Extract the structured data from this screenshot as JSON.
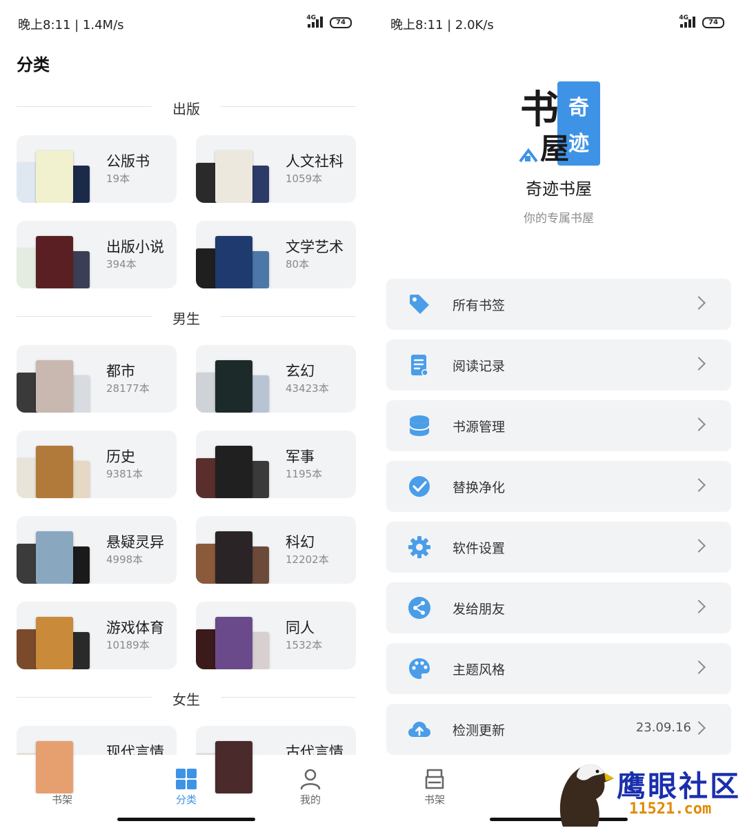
{
  "left": {
    "status": {
      "time": "晚上8:11 | 1.4M/s",
      "network": "4G",
      "battery": "74"
    },
    "title": "分类",
    "sections": [
      {
        "label": "出版"
      },
      {
        "label": "男生"
      },
      {
        "label": "女生"
      }
    ],
    "categories": [
      {
        "name": "公版书",
        "count": "19本"
      },
      {
        "name": "人文社科",
        "count": "1059本"
      },
      {
        "name": "出版小说",
        "count": "394本"
      },
      {
        "name": "文学艺术",
        "count": "80本"
      },
      {
        "name": "都市",
        "count": "28177本"
      },
      {
        "name": "玄幻",
        "count": "43423本"
      },
      {
        "name": "历史",
        "count": "9381本"
      },
      {
        "name": "军事",
        "count": "1195本"
      },
      {
        "name": "悬疑灵异",
        "count": "4998本"
      },
      {
        "name": "科幻",
        "count": "12202本"
      },
      {
        "name": "游戏体育",
        "count": "10189本"
      },
      {
        "name": "同人",
        "count": "1532本"
      },
      {
        "name": "现代言情",
        "count": ""
      },
      {
        "name": "古代言情",
        "count": ""
      }
    ],
    "tabs": [
      {
        "label": "书架",
        "icon": "bookshelf-icon"
      },
      {
        "label": "分类",
        "icon": "category-grid-icon",
        "active": true
      },
      {
        "label": "我的",
        "icon": "person-icon"
      }
    ]
  },
  "right": {
    "status": {
      "time": "晚上8:11 | 2.0K/s",
      "network": "4G",
      "battery": "74"
    },
    "logo": {
      "text_main": "书屋",
      "text_side": "奇迹"
    },
    "app_name": "奇迹书屋",
    "slogan": "你的专属书屋",
    "menu": [
      {
        "label": "所有书签",
        "icon": "tag-icon",
        "value": ""
      },
      {
        "label": "阅读记录",
        "icon": "document-icon",
        "value": ""
      },
      {
        "label": "书源管理",
        "icon": "database-icon",
        "value": ""
      },
      {
        "label": "替换净化",
        "icon": "check-circle-icon",
        "value": ""
      },
      {
        "label": "软件设置",
        "icon": "gear-icon",
        "value": ""
      },
      {
        "label": "发给朋友",
        "icon": "share-icon",
        "value": ""
      },
      {
        "label": "主题风格",
        "icon": "palette-icon",
        "value": ""
      },
      {
        "label": "检测更新",
        "icon": "cloud-upload-icon",
        "value": "23.09.16"
      }
    ],
    "tabs": [
      {
        "label": "书架",
        "icon": "bookshelf-icon"
      }
    ],
    "watermark": {
      "text": "鹰眼社区",
      "url": "11521.com"
    }
  },
  "colors": {
    "accent": "#3f93e6",
    "card_bg": "#f2f3f5",
    "icon_blue": "#4a9de8"
  }
}
